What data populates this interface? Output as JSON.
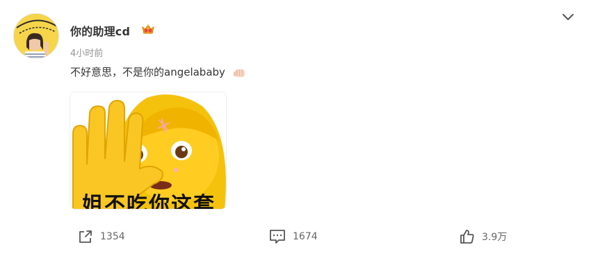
{
  "post": {
    "username": "你的助理cd",
    "timestamp": "4小时前",
    "text": "不好意思，不是你的angelababy",
    "avatar_icon": "avatar-photo-happy-birthday",
    "badge_icon": "vip-crown-badge-icon",
    "text_emoji_icon": "fist-bump-icon",
    "image": {
      "caption": "姐不吃你这套",
      "emoji": "woman-facepalm-stop-hand-emoji"
    }
  },
  "actions": {
    "share_count": "1354",
    "comment_count": "1674",
    "like_count": "3.9万"
  },
  "menu_icon": "chevron-down-icon",
  "colors": {
    "text": "#333333",
    "muted": "#939393",
    "action": "#666666",
    "emoji_yellow": "#f4c20d"
  }
}
